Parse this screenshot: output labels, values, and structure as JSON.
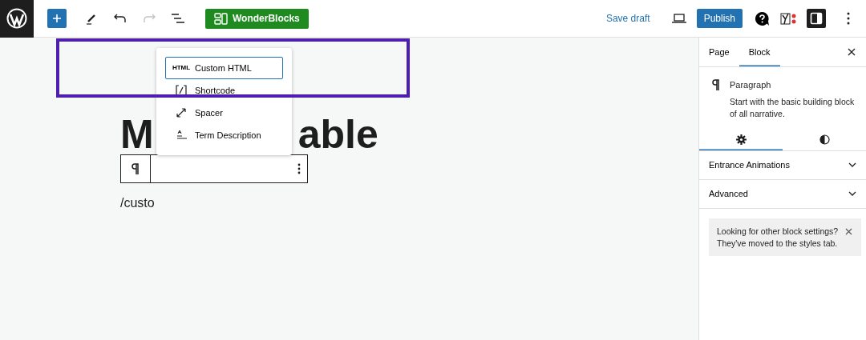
{
  "topbar": {
    "history": {
      "undo_disabled": false,
      "redo_disabled": true
    },
    "wonderblocks": "WonderBlocks",
    "save_draft": "Save draft",
    "publish": "Publish"
  },
  "canvas": {
    "title_parts": [
      "M",
      "able"
    ],
    "paragraph": "/custo"
  },
  "inserter": {
    "items": [
      {
        "kind": "html",
        "icon_text": "HTML",
        "label": "Custom HTML",
        "selected": true
      },
      {
        "kind": "shortcode",
        "label": "Shortcode",
        "selected": false
      },
      {
        "kind": "spacer",
        "label": "Spacer",
        "selected": false
      },
      {
        "kind": "term",
        "label": "Term Description",
        "selected": false
      }
    ]
  },
  "sidebar": {
    "tabs": [
      {
        "label": "Page",
        "selected": false
      },
      {
        "label": "Block",
        "selected": true
      }
    ],
    "block": {
      "name": "Paragraph",
      "description": "Start with the basic building block of all narrative."
    },
    "subtabs": [
      {
        "kind": "settings",
        "selected": true
      },
      {
        "kind": "styles",
        "selected": false
      }
    ],
    "panels": [
      {
        "label": "Entrance Animations",
        "expanded": false
      },
      {
        "label": "Advanced",
        "expanded": false
      }
    ],
    "notice": "Looking for other block settings? They've moved to the styles tab."
  }
}
